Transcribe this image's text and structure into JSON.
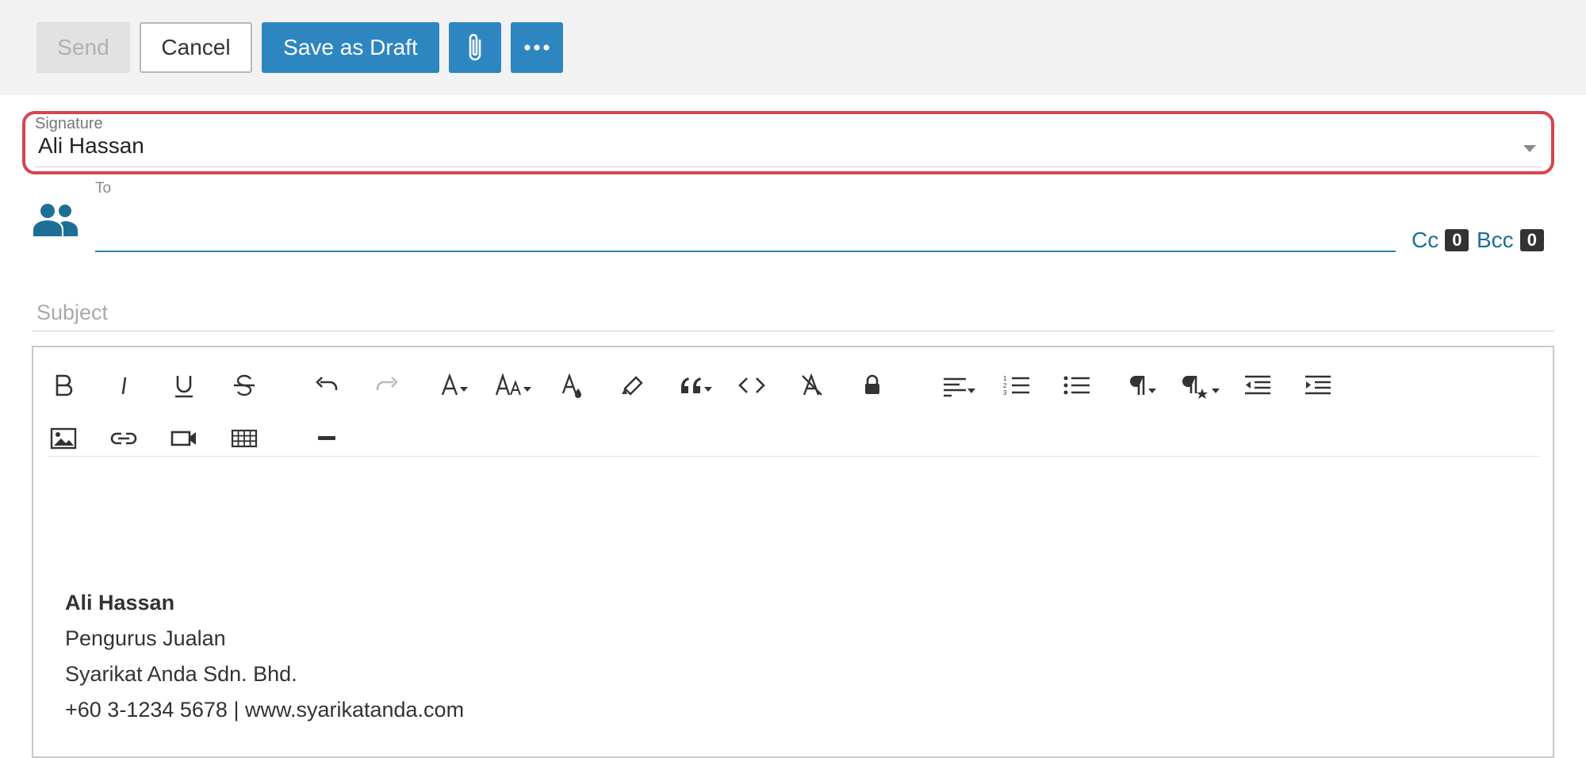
{
  "toolbar": {
    "send_label": "Send",
    "cancel_label": "Cancel",
    "save_draft_label": "Save as Draft",
    "attach_icon": "paperclip-icon",
    "more_icon": "ellipsis-icon"
  },
  "signature": {
    "label": "Signature",
    "value": "Ali Hassan"
  },
  "to": {
    "label": "To",
    "value": "",
    "cc_label": "Cc",
    "cc_count": "0",
    "bcc_label": "Bcc",
    "bcc_count": "0"
  },
  "subject": {
    "placeholder": "Subject",
    "value": ""
  },
  "editor": {
    "toolbar_row1": [
      "bold",
      "italic",
      "underline",
      "strikethrough",
      "undo",
      "redo",
      "font-family",
      "font-size",
      "font-color",
      "highlight",
      "blockquote",
      "code",
      "clear-formatting",
      "lock",
      "align",
      "ordered-list",
      "unordered-list",
      "paragraph-format",
      "paragraph-style",
      "outdent",
      "indent"
    ],
    "toolbar_row2": [
      "insert-image",
      "insert-link",
      "insert-video",
      "insert-table",
      "horizontal-rule"
    ],
    "body": {
      "signature_lines": [
        "Ali Hassan",
        "Pengurus Jualan",
        "Syarikat Anda Sdn. Bhd.",
        "+60 3-1234 5678 | www.syarikatanda.com"
      ]
    }
  },
  "colors": {
    "primary": "#2e86c1",
    "highlight_border": "#d9434f",
    "link": "#1e6f96",
    "icon_blue": "#1e6f96"
  }
}
